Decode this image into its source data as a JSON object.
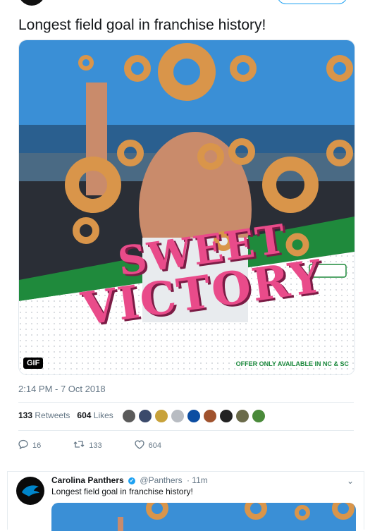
{
  "tweet": {
    "text": "Longest field goal in franchise history!",
    "gif_badge": "GIF",
    "promo_line1": "SWEET",
    "promo_line2": "VICTORY",
    "offer_text": "OFFER ONLY AVAILABLE IN NC & SC",
    "timestamp": "2:14 PM - 7 Oct 2018",
    "retweets_count": "133",
    "retweets_label": "Retweets",
    "likes_count": "604",
    "likes_label": "Likes",
    "replies": "16",
    "retweets": "133",
    "likes": "604"
  },
  "reply": {
    "name": "Carolina Panthers",
    "handle": "@Panthers",
    "time": "· 11m",
    "text": "Longest field goal in franchise history!"
  },
  "colors": {
    "accent": "#1da1f2",
    "promo_pink": "#e94b8a",
    "turf": "#1f8a3c",
    "sky": "#3a8fd6",
    "donut": "#d9954a"
  }
}
